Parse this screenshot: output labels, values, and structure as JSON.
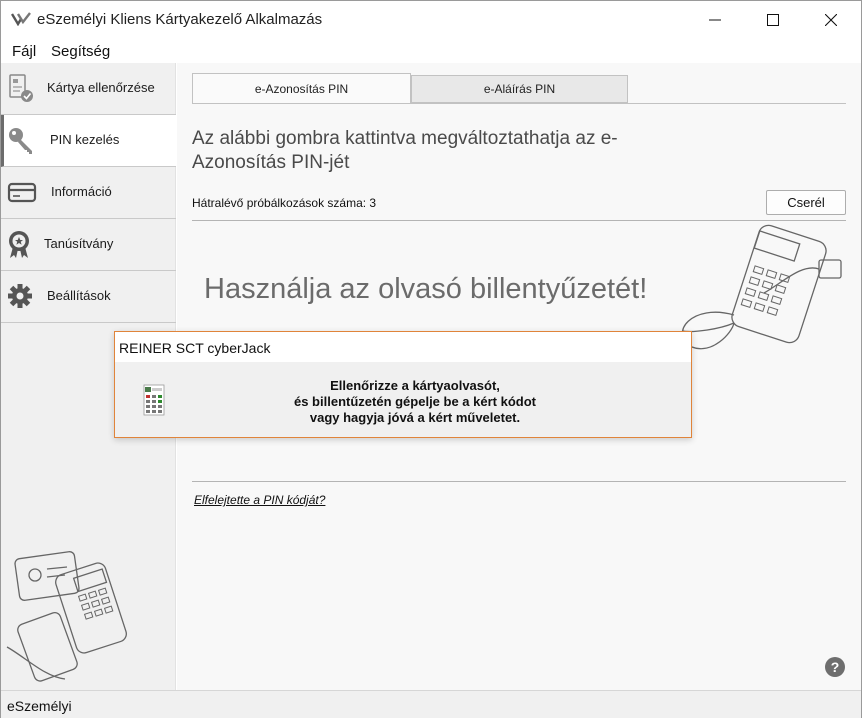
{
  "window": {
    "title": "eSzemélyi Kliens Kártyakezelő Alkalmazás"
  },
  "menu": {
    "file": "Fájl",
    "help": "Segítség"
  },
  "sidebar": {
    "items": [
      {
        "label": "Kártya ellenőrzése",
        "icon": "card-check-icon"
      },
      {
        "label": "PIN kezelés",
        "icon": "key-icon",
        "active": true
      },
      {
        "label": "Információ",
        "icon": "card-icon"
      },
      {
        "label": "Tanúsítvány",
        "icon": "certificate-icon"
      },
      {
        "label": "Beállítások",
        "icon": "gear-icon"
      }
    ]
  },
  "tabs": [
    {
      "label": "e-Azonosítás PIN",
      "active": true
    },
    {
      "label": "e-Aláírás PIN",
      "active": false
    }
  ],
  "main": {
    "heading": "Az alábbi gombra kattintva megváltoztathatja az e-Azonosítás PIN-jét",
    "retries_text": "Hátralévő próbálkozások száma: 3",
    "change_button": "Cserél",
    "reader_message": "Használja az olvasó billentyűzetét!",
    "forgot_link": "Elfelejtette a PIN kódját?",
    "help": "?"
  },
  "dialog": {
    "title": "REINER SCT cyberJack",
    "line1": "Ellenőrizze a kártyaolvasót,",
    "line2": "és billentűzetén gépelje be a kért kódot",
    "line3": "vagy hagyja jóvá a kért műveletet."
  },
  "statusbar": {
    "text": "eSzemélyi"
  },
  "colors": {
    "dialog_border": "#e0843a",
    "sidebar_bg": "#f0f0f0",
    "main_bg": "#f8f8f8"
  }
}
